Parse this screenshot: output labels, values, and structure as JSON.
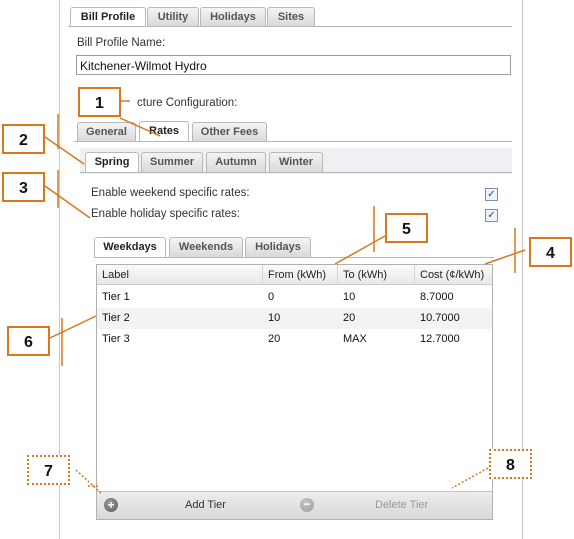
{
  "top_tabs": [
    "Bill Profile",
    "Utility",
    "Holidays",
    "Sites"
  ],
  "profile_name_label": "Bill Profile Name:",
  "profile_name_value": "Kitchener-Wilmot Hydro",
  "structure_config_label": "cture Configuration:",
  "config_tabs": [
    "General",
    "Rates",
    "Other Fees"
  ],
  "season_tabs": [
    "Spring",
    "Summer",
    "Autumn",
    "Winter"
  ],
  "weekend_label": "Enable weekend specific rates:",
  "holiday_label": "Enable holiday specific rates:",
  "day_tabs": [
    "Weekdays",
    "Weekends",
    "Holidays"
  ],
  "columns": [
    "Label",
    "From (kWh)",
    "To (kWh)",
    "Cost (¢/kWh)"
  ],
  "rows": [
    [
      "Tier 1",
      "0",
      "10",
      "8.7000"
    ],
    [
      "Tier 2",
      "10",
      "20",
      "10.7000"
    ],
    [
      "Tier 3",
      "20",
      "MAX",
      "12.7000"
    ]
  ],
  "add_tier": "Add Tier",
  "delete_tier": "Delete Tier",
  "callouts": [
    "1",
    "2",
    "3",
    "4",
    "5",
    "6",
    "7",
    "8"
  ],
  "colors": {
    "callout_border": "#d9771c",
    "tab_border": "#b9b9b9"
  },
  "icons": {
    "checkbox": "check-icon",
    "add": "plus-circle-icon",
    "delete": "minus-circle-icon"
  }
}
